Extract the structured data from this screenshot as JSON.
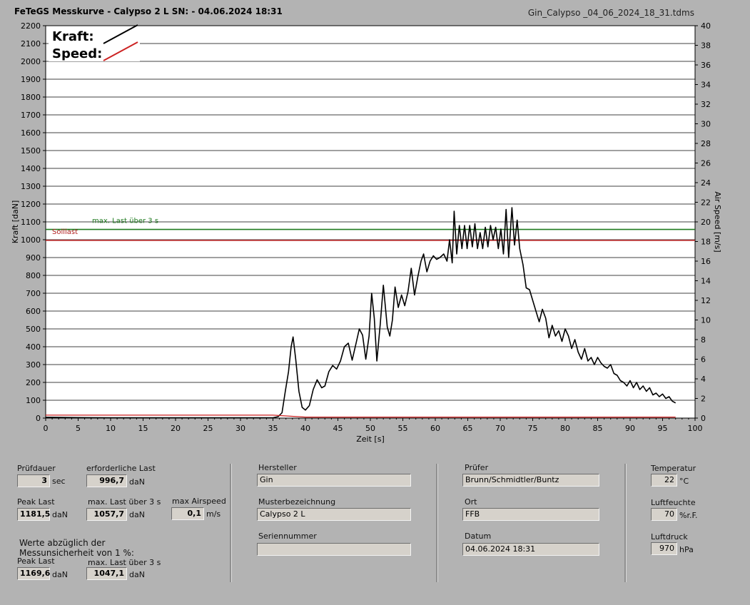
{
  "header": {
    "title": "FeTeGS Messkurve - Calypso 2 L  SN:  - 04.06.2024 18:31",
    "filename": "Gin_Calypso _04_06_2024_18_31.tdms"
  },
  "chart_data": {
    "type": "line",
    "xlabel": "Zeit [s]",
    "ylabel": "Kraft [daN]",
    "y2label": "Air Speed [m/s]",
    "xlim": [
      0,
      100
    ],
    "ylim": [
      0,
      2200
    ],
    "y2lim": [
      0,
      40
    ],
    "x_ticks": [
      "0",
      "5",
      "10",
      "15",
      "20",
      "25",
      "30",
      "35",
      "40",
      "45",
      "50",
      "55",
      "60",
      "65",
      "70",
      "75",
      "80",
      "85",
      "90",
      "95",
      "100"
    ],
    "y_ticks": [
      "0",
      "100",
      "200",
      "300",
      "400",
      "500",
      "600",
      "700",
      "800",
      "900",
      "1000",
      "1100",
      "1200",
      "1300",
      "1400",
      "1500",
      "1600",
      "1700",
      "1800",
      "1900",
      "2000",
      "2100",
      "2200"
    ],
    "y2_ticks": [
      "0",
      "2",
      "4",
      "6",
      "8",
      "10",
      "12",
      "14",
      "16",
      "18",
      "20",
      "22",
      "24",
      "26",
      "28",
      "30",
      "32",
      "34",
      "36",
      "38",
      "40"
    ],
    "grid": true,
    "legend": {
      "position": "top-left",
      "items": [
        {
          "name": "Kraft:",
          "color": "#000000"
        },
        {
          "name": "Speed:",
          "color": "#cc2222"
        }
      ]
    },
    "reference_lines": [
      {
        "name": "max. Last über  3 s",
        "y": 1057.7,
        "color": "#1e7a1e"
      },
      {
        "name": "Solllast",
        "y": 996.7,
        "color": "#b22222"
      }
    ],
    "series": [
      {
        "name": "Kraft:",
        "color": "#000000",
        "points": [
          [
            0,
            5
          ],
          [
            5,
            3
          ],
          [
            10,
            2
          ],
          [
            15,
            2
          ],
          [
            20,
            2
          ],
          [
            25,
            2
          ],
          [
            30,
            2
          ],
          [
            35,
            2
          ],
          [
            35.8,
            8
          ],
          [
            36.4,
            30
          ],
          [
            36.9,
            150
          ],
          [
            37.4,
            260
          ],
          [
            37.8,
            400
          ],
          [
            38.1,
            455
          ],
          [
            38.5,
            330
          ],
          [
            39,
            150
          ],
          [
            39.5,
            60
          ],
          [
            40,
            45
          ],
          [
            40.6,
            70
          ],
          [
            41.2,
            160
          ],
          [
            41.8,
            215
          ],
          [
            42.5,
            170
          ],
          [
            43,
            180
          ],
          [
            43.6,
            260
          ],
          [
            44.2,
            295
          ],
          [
            44.8,
            275
          ],
          [
            45.4,
            320
          ],
          [
            46,
            400
          ],
          [
            46.6,
            420
          ],
          [
            47.2,
            325
          ],
          [
            47.8,
            420
          ],
          [
            48.3,
            500
          ],
          [
            48.8,
            465
          ],
          [
            49.3,
            330
          ],
          [
            49.8,
            460
          ],
          [
            50.2,
            700
          ],
          [
            50.6,
            560
          ],
          [
            51,
            320
          ],
          [
            51.5,
            520
          ],
          [
            52,
            745
          ],
          [
            52.6,
            510
          ],
          [
            53,
            460
          ],
          [
            53.4,
            550
          ],
          [
            53.8,
            735
          ],
          [
            54.3,
            620
          ],
          [
            54.8,
            690
          ],
          [
            55.3,
            630
          ],
          [
            55.8,
            710
          ],
          [
            56.3,
            840
          ],
          [
            56.8,
            690
          ],
          [
            57.3,
            790
          ],
          [
            57.8,
            880
          ],
          [
            58.2,
            920
          ],
          [
            58.7,
            820
          ],
          [
            59.2,
            880
          ],
          [
            59.7,
            910
          ],
          [
            60.2,
            890
          ],
          [
            60.7,
            900
          ],
          [
            61.3,
            920
          ],
          [
            61.8,
            880
          ],
          [
            62.2,
            1000
          ],
          [
            62.6,
            870
          ],
          [
            62.9,
            1160
          ],
          [
            63.3,
            920
          ],
          [
            63.7,
            1080
          ],
          [
            64.1,
            950
          ],
          [
            64.5,
            1080
          ],
          [
            64.9,
            950
          ],
          [
            65.3,
            1080
          ],
          [
            65.7,
            960
          ],
          [
            66.1,
            1090
          ],
          [
            66.5,
            950
          ],
          [
            66.9,
            1040
          ],
          [
            67.3,
            950
          ],
          [
            67.7,
            1070
          ],
          [
            68.1,
            960
          ],
          [
            68.5,
            1080
          ],
          [
            68.9,
            1000
          ],
          [
            69.3,
            1070
          ],
          [
            69.7,
            950
          ],
          [
            70.1,
            1060
          ],
          [
            70.5,
            920
          ],
          [
            70.9,
            1170
          ],
          [
            71.3,
            900
          ],
          [
            71.8,
            1180
          ],
          [
            72.2,
            970
          ],
          [
            72.6,
            1110
          ],
          [
            73,
            950
          ],
          [
            73.5,
            860
          ],
          [
            74,
            730
          ],
          [
            74.5,
            720
          ],
          [
            75,
            660
          ],
          [
            75.5,
            600
          ],
          [
            76,
            540
          ],
          [
            76.5,
            610
          ],
          [
            77,
            560
          ],
          [
            77.5,
            450
          ],
          [
            78,
            520
          ],
          [
            78.5,
            460
          ],
          [
            79,
            490
          ],
          [
            79.5,
            430
          ],
          [
            80,
            500
          ],
          [
            80.5,
            460
          ],
          [
            81,
            390
          ],
          [
            81.5,
            440
          ],
          [
            82,
            370
          ],
          [
            82.5,
            330
          ],
          [
            83,
            390
          ],
          [
            83.5,
            320
          ],
          [
            84,
            340
          ],
          [
            84.5,
            300
          ],
          [
            85,
            340
          ],
          [
            85.5,
            310
          ],
          [
            86,
            290
          ],
          [
            86.5,
            280
          ],
          [
            87,
            300
          ],
          [
            87.5,
            250
          ],
          [
            88,
            240
          ],
          [
            88.5,
            210
          ],
          [
            89,
            200
          ],
          [
            89.5,
            180
          ],
          [
            90,
            210
          ],
          [
            90.5,
            170
          ],
          [
            91,
            200
          ],
          [
            91.5,
            160
          ],
          [
            92,
            180
          ],
          [
            92.5,
            150
          ],
          [
            93,
            170
          ],
          [
            93.5,
            130
          ],
          [
            94,
            140
          ],
          [
            94.5,
            120
          ],
          [
            95,
            135
          ],
          [
            95.5,
            110
          ],
          [
            96,
            120
          ],
          [
            96.5,
            95
          ],
          [
            97,
            85
          ]
        ]
      },
      {
        "name": "Speed:",
        "color": "#cc2222",
        "points": [
          [
            0,
            0.3
          ],
          [
            5,
            0.3
          ],
          [
            10,
            0.3
          ],
          [
            15,
            0.3
          ],
          [
            20,
            0.3
          ],
          [
            25,
            0.3
          ],
          [
            30,
            0.3
          ],
          [
            35,
            0.3
          ],
          [
            40,
            0.1
          ],
          [
            50,
            0.1
          ],
          [
            60,
            0.1
          ],
          [
            70,
            0.1
          ],
          [
            80,
            0.1
          ],
          [
            90,
            0.1
          ],
          [
            97,
            0.1
          ]
        ]
      }
    ]
  },
  "panel": {
    "pruefdauer": {
      "label": "Prüfdauer",
      "value": "3",
      "unit": "sec"
    },
    "erforderliche_last": {
      "label": "erforderliche Last",
      "value": "996,7",
      "unit": "daN"
    },
    "peak_last": {
      "label": "Peak Last",
      "value": "1181,5",
      "unit": "daN"
    },
    "max_last": {
      "label": "max. Last über  3 s",
      "value": "1057,7",
      "unit": "daN"
    },
    "max_airspeed": {
      "label": "max Airspeed",
      "value": "0,1",
      "unit": "m/s"
    },
    "note_line1": "Werte abzüglich der",
    "note_line2": "Messunsicherheit von 1  %:",
    "peak_last_corr": {
      "label": "Peak Last",
      "value": "1169,6",
      "unit": "daN"
    },
    "max_last_corr": {
      "label": "max. Last über  3 s",
      "value": "1047,1",
      "unit": "daN"
    },
    "hersteller": {
      "label": "Hersteller",
      "value": "Gin"
    },
    "muster": {
      "label": "Musterbezeichnung",
      "value": "Calypso 2 L"
    },
    "serien": {
      "label": "Seriennummer",
      "value": ""
    },
    "pruefer": {
      "label": "Prüfer",
      "value": "Brunn/Schmidtler/Buntz"
    },
    "ort": {
      "label": "Ort",
      "value": "FFB"
    },
    "datum": {
      "label": "Datum",
      "value": "04.06.2024 18:31"
    },
    "temperatur": {
      "label": "Temperatur",
      "value": "22",
      "unit": "°C"
    },
    "luftfeuchte": {
      "label": "Luftfeuchte",
      "value": "70",
      "unit": "%r.F."
    },
    "luftdruck": {
      "label": "Luftdruck",
      "value": "970",
      "unit": "hPa"
    }
  }
}
